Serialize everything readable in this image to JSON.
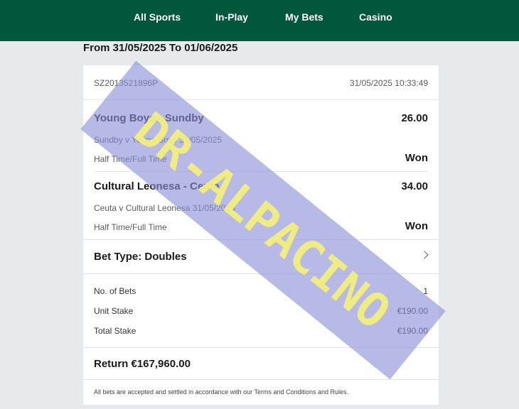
{
  "nav": {
    "items": [
      "All Sports",
      "In-Play",
      "My Bets",
      "Casino"
    ]
  },
  "date_range": "From 31/05/2025 To 01/06/2025",
  "bet": {
    "ref": "SZ2013521896P",
    "placed": "31/05/2025 10:33:49",
    "selections": [
      {
        "title": "Young Boys - Sundby",
        "odds": "26.00",
        "event": "Sundby v Young Boys 31/05/2025",
        "market": "Half Time/Full Time",
        "result": "Won"
      },
      {
        "title": "Cultural Leonesa - Ceuta",
        "odds": "34.00",
        "event": "Ceuta v Cultural Leonesa 31/05/2025",
        "market": "Half Time/Full Time",
        "result": "Won"
      }
    ],
    "bet_type": "Bet Type: Doubles",
    "no_of_bets_label": "No. of Bets",
    "no_of_bets": "1",
    "unit_stake_label": "Unit Stake",
    "unit_stake": "€190.00",
    "total_stake_label": "Total Stake",
    "total_stake": "€190.00",
    "return": "Return €167,960.00",
    "footer": "All bets are accepted and settled in accordance with our Terms and Conditions and Rules."
  },
  "watermark": {
    "text": "DR-ALPACINO",
    "band_color": "#8a8fd6",
    "text_color": "#f3f07a"
  },
  "colors": {
    "header_bg": "#01573b",
    "page_bg": "#e8e9eb",
    "card_bg": "#ffffff"
  }
}
